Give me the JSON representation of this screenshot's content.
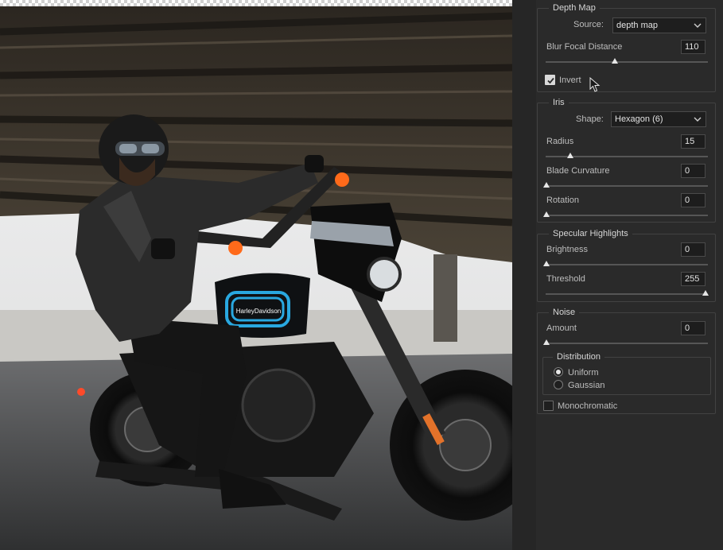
{
  "depth_map": {
    "title": "Depth Map",
    "source_label": "Source:",
    "source_value": "depth map",
    "blur_label": "Blur Focal Distance",
    "blur_value": "110",
    "invert_label": "Invert",
    "invert_checked": true
  },
  "iris": {
    "title": "Iris",
    "shape_label": "Shape:",
    "shape_value": "Hexagon (6)",
    "radius_label": "Radius",
    "radius_value": "15",
    "curvature_label": "Blade Curvature",
    "curvature_value": "0",
    "rotation_label": "Rotation",
    "rotation_value": "0"
  },
  "specular": {
    "title": "Specular Highlights",
    "brightness_label": "Brightness",
    "brightness_value": "0",
    "threshold_label": "Threshold",
    "threshold_value": "255"
  },
  "noise": {
    "title": "Noise",
    "amount_label": "Amount",
    "amount_value": "0",
    "distribution_title": "Distribution",
    "uniform_label": "Uniform",
    "gaussian_label": "Gaussian",
    "selected_distribution": "Uniform",
    "mono_label": "Monochromatic",
    "mono_checked": false
  },
  "photo": {
    "tank_brand": "HarleyDavidson"
  },
  "colors": {
    "panel_bg": "#2a2a2a",
    "field_bg": "#1d1d1d",
    "text": "#c9c9c9",
    "tank_stripe": "#29a8e0"
  }
}
